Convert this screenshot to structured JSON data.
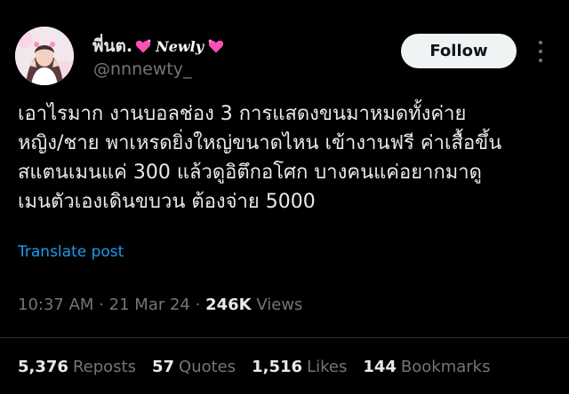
{
  "user": {
    "display_name": "พี่นต.",
    "display_name_script": "Newly",
    "handle": "@nnnewty_",
    "heart_color": "#ff4fb4",
    "avatar_icon": "profile-photo"
  },
  "actions": {
    "follow_label": "Follow",
    "more_icon": "more-dots-vertical"
  },
  "tweet": {
    "lines": [
      "เอาไรมาก งานบอลช่อง 3 การแสดงขนมาหมดทั้งค่าย",
      "หญิง/ชาย พาเหรดยิ่งใหญ่ขนาดไหน เข้างานฟรี ค่าเสื้อขึ้น",
      "สแตนเมนแค่ 300 แล้วดูอิตึกอโศก บางคนแค่อยากมาดู",
      "เมนตัวเองเดินขบวน ต้องจ่าย 5000"
    ],
    "translate_label": "Translate post"
  },
  "meta": {
    "time": "10:37 AM",
    "separator": "·",
    "date": "21 Mar 24",
    "views_count": "246K",
    "views_label": "Views"
  },
  "stats": {
    "reposts_count": "5,376",
    "reposts_label": "Reposts",
    "quotes_count": "57",
    "quotes_label": "Quotes",
    "likes_count": "1,516",
    "likes_label": "Likes",
    "bookmarks_count": "144",
    "bookmarks_label": "Bookmarks"
  },
  "colors": {
    "background": "#000000",
    "text_primary": "#e7e9ea",
    "text_secondary": "#71767b",
    "link": "#1d9bf0",
    "divider": "#2f3336",
    "button_bg": "#eff3f4"
  }
}
